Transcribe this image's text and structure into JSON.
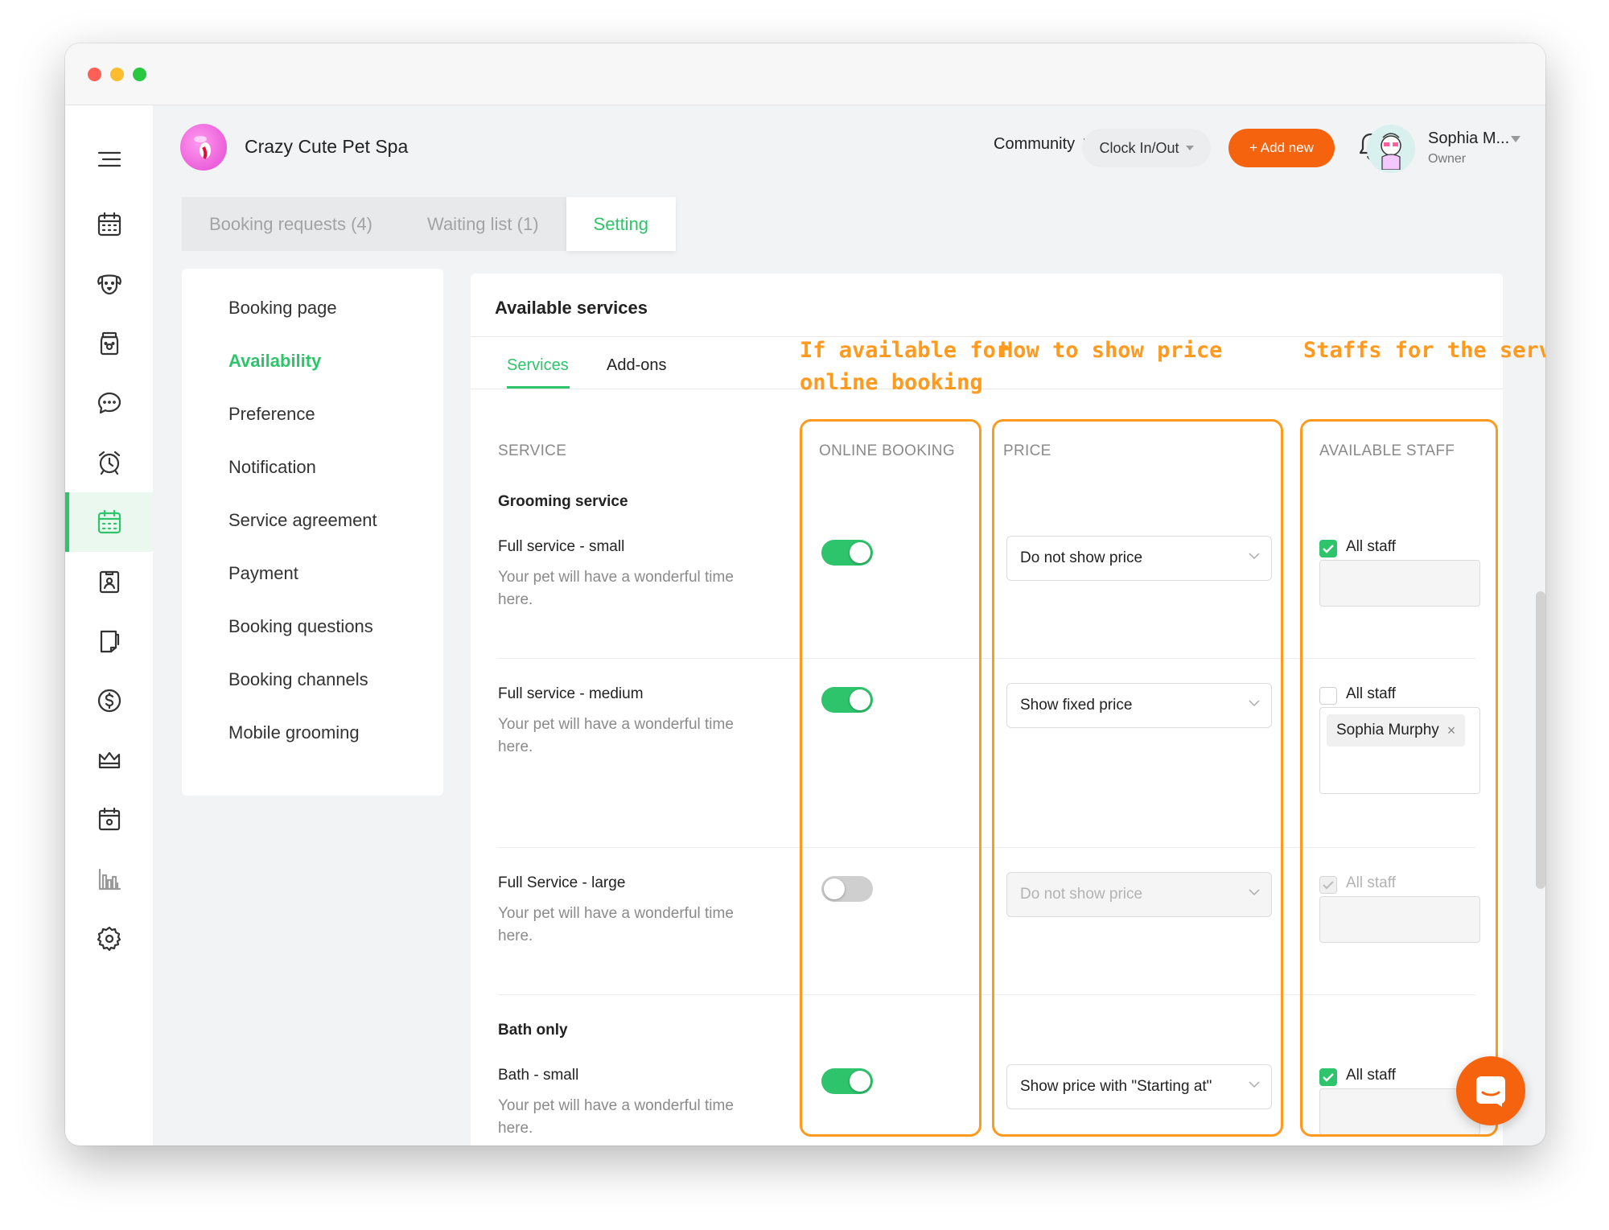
{
  "business": {
    "name": "Crazy Cute Pet Spa"
  },
  "header": {
    "community_label": "Community",
    "clock_label": "Clock In/Out",
    "add_new_label": "+ Add new",
    "user_name": "Sophia M...",
    "user_role": "Owner"
  },
  "sidebar": {
    "items": [
      {
        "icon": "menu-icon"
      },
      {
        "icon": "calendar-icon"
      },
      {
        "icon": "pet-face-icon"
      },
      {
        "icon": "pet-food-jar-icon"
      },
      {
        "icon": "message-icon"
      },
      {
        "icon": "alarm-clock-icon"
      },
      {
        "icon": "booking-calendar-icon",
        "active": true
      },
      {
        "icon": "staff-badge-icon"
      },
      {
        "icon": "book-icon"
      },
      {
        "icon": "dollar-icon"
      },
      {
        "icon": "crown-icon"
      },
      {
        "icon": "calendar-check-icon"
      },
      {
        "icon": "bar-chart-icon"
      },
      {
        "icon": "gear-icon"
      }
    ]
  },
  "tabs": [
    {
      "label": "Booking requests (4)"
    },
    {
      "label": "Waiting list (1)"
    },
    {
      "label": "Setting",
      "active": true
    }
  ],
  "settings_menu": [
    {
      "label": "Booking page"
    },
    {
      "label": "Availability",
      "active": true
    },
    {
      "label": "Preference"
    },
    {
      "label": "Notification"
    },
    {
      "label": "Service agreement"
    },
    {
      "label": "Payment"
    },
    {
      "label": "Booking questions"
    },
    {
      "label": "Booking channels"
    },
    {
      "label": "Mobile grooming"
    }
  ],
  "panel": {
    "title": "Available services",
    "subtabs": [
      {
        "label": "Services",
        "active": true
      },
      {
        "label": "Add-ons"
      }
    ],
    "columns": {
      "service": "SERVICE",
      "online_booking": "ONLINE BOOKING",
      "price": "PRICE",
      "available_staff": "AVAILABLE STAFF"
    },
    "groups": [
      {
        "title": "Grooming service",
        "services": [
          {
            "name": "Full service - small",
            "description": "Your pet will have a wonderful time here.",
            "online_booking": true,
            "price_option": "Do not show price",
            "all_staff": true,
            "staff": []
          },
          {
            "name": "Full service - medium",
            "description": "Your pet will have a wonderful time here.",
            "online_booking": true,
            "price_option": "Show fixed price",
            "all_staff": false,
            "staff": [
              "Sophia Murphy"
            ]
          },
          {
            "name": "Full Service - large",
            "description": "Your pet will have a wonderful time here.",
            "online_booking": false,
            "price_option": "Do not show price",
            "all_staff": true,
            "staff": []
          }
        ]
      },
      {
        "title": "Bath only",
        "services": [
          {
            "name": "Bath - small",
            "description": "Your pet will have a wonderful time here.",
            "online_booking": true,
            "price_option": "Show price with \"Starting at\"",
            "all_staff": true,
            "staff": []
          }
        ]
      }
    ],
    "all_staff_label": "All staff",
    "chip_remove": "×"
  },
  "annotations": {
    "online_booking_line1": "If available for",
    "online_booking_line2": "online booking",
    "price": "How to show price",
    "staff": "Staffs for the service"
  },
  "colors": {
    "accent_green": "#2ec46b",
    "accent_orange": "#f6630f",
    "annotation_orange": "#ff9a1f"
  }
}
